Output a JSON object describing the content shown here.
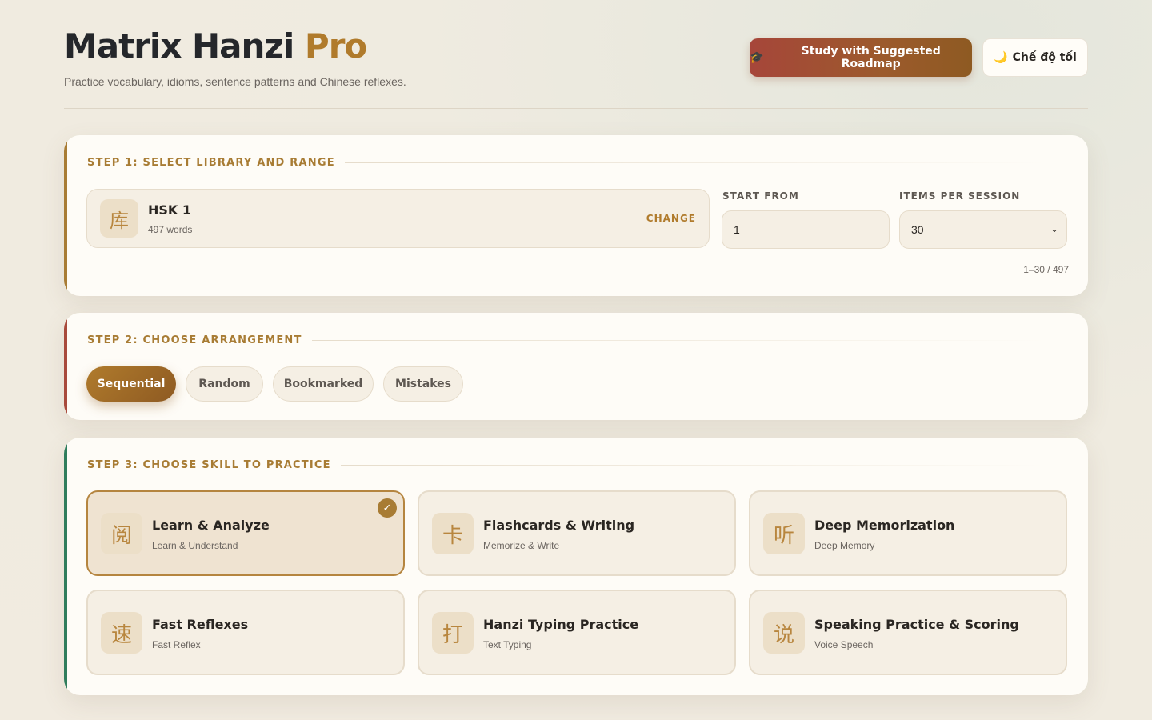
{
  "header": {
    "title_main": "Matrix Hanzi",
    "title_accent": "Pro",
    "subtitle": "Practice vocabulary, idioms, sentence patterns and Chinese reflexes.",
    "roadmap_button": "Study with Suggested Roadmap",
    "roadmap_icon": "🎓",
    "dark_mode_button": "Chế độ tối",
    "dark_mode_icon": "🌙"
  },
  "step1": {
    "title": "STEP 1: SELECT LIBRARY AND RANGE",
    "library": {
      "glyph": "库",
      "name": "HSK 1",
      "count": "497 words",
      "change_label": "CHANGE"
    },
    "start_from": {
      "label": "START FROM",
      "value": "1"
    },
    "items_per_session": {
      "label": "ITEMS PER SESSION",
      "value": "30"
    },
    "range_note": "1–30 / 497"
  },
  "step2": {
    "title": "STEP 2: CHOOSE ARRANGEMENT",
    "options": [
      "Sequential",
      "Random",
      "Bookmarked",
      "Mistakes"
    ],
    "selected": "Sequential"
  },
  "step3": {
    "title": "STEP 3: CHOOSE SKILL TO PRACTICE",
    "skills": [
      {
        "glyph": "阅",
        "name": "Learn & Analyze",
        "sub": "Learn & Understand",
        "selected": true
      },
      {
        "glyph": "卡",
        "name": "Flashcards & Writing",
        "sub": "Memorize & Write",
        "selected": false
      },
      {
        "glyph": "听",
        "name": "Deep Memorization",
        "sub": "Deep Memory",
        "selected": false
      },
      {
        "glyph": "速",
        "name": "Fast Reflexes",
        "sub": "Fast Reflex",
        "selected": false
      },
      {
        "glyph": "打",
        "name": "Hanzi Typing Practice",
        "sub": "Text Typing",
        "selected": false
      },
      {
        "glyph": "说",
        "name": "Speaking Practice & Scoring",
        "sub": "Voice Speech",
        "selected": false
      }
    ],
    "check_glyph": "✓"
  },
  "colors": {
    "accent": "#b07b2c",
    "step1_bar": "#a87c34",
    "step2_bar": "#a84a3c",
    "step3_bar": "#2f7d5c"
  }
}
